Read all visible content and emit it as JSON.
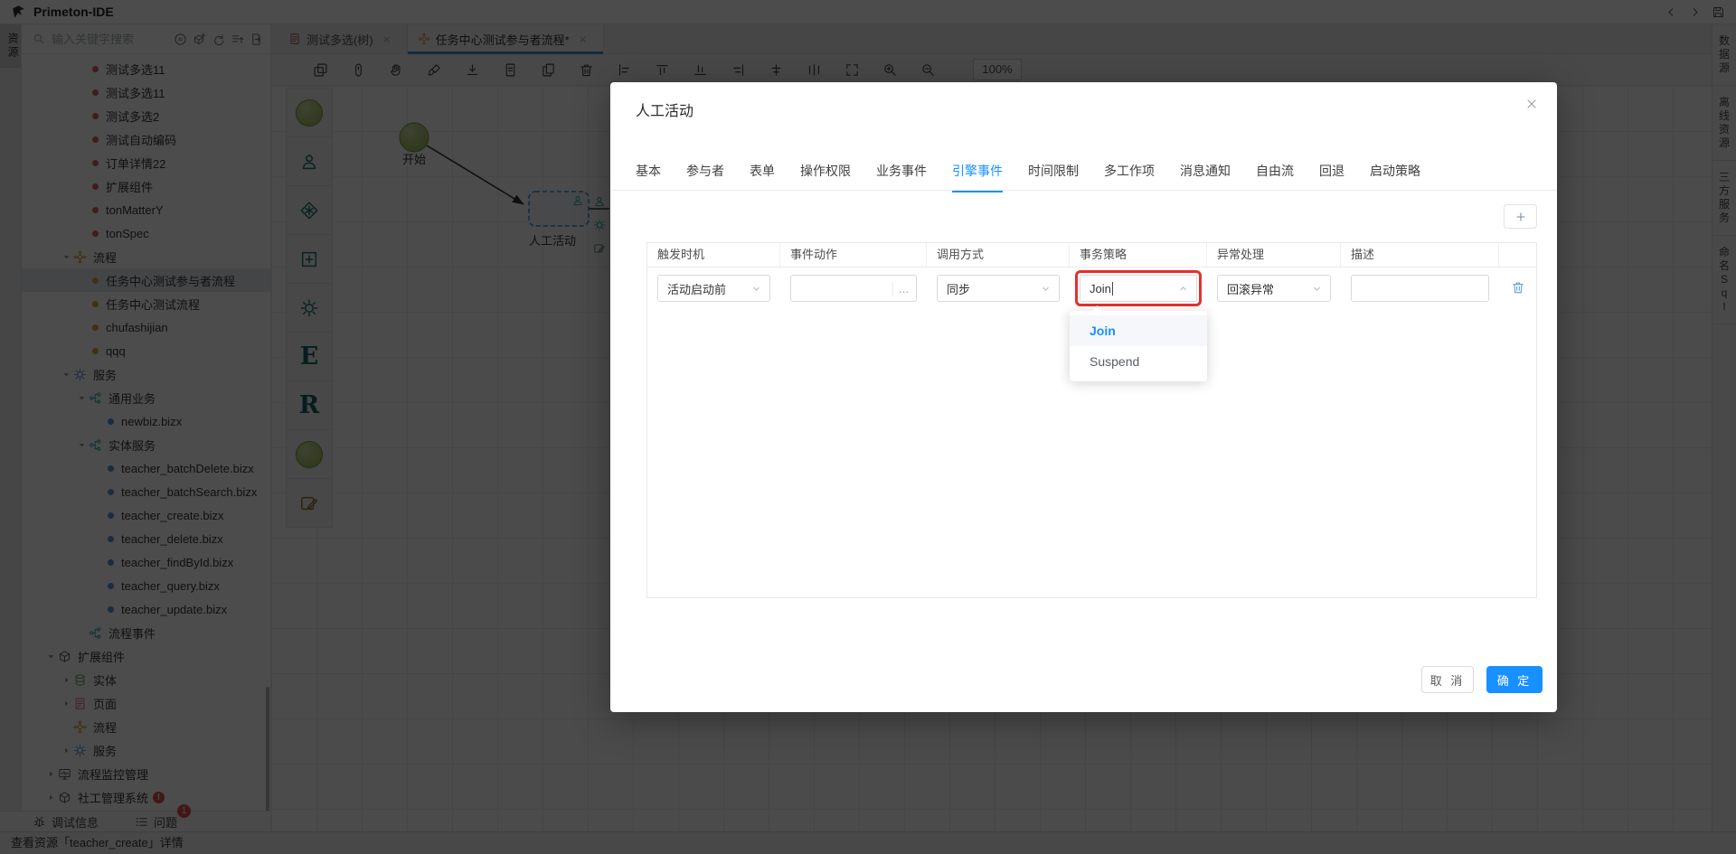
{
  "window": {
    "app_title": "Primeton-IDE",
    "titlebar_icons": [
      "back-icon",
      "forward-icon",
      "save-icon"
    ]
  },
  "left_rail": {
    "tab": "资源"
  },
  "sidebar": {
    "search": {
      "placeholder": "输入关键字搜索",
      "icons": [
        "ai-icon",
        "cube-add-icon",
        "refresh-icon",
        "list-top-icon",
        "export-icon"
      ]
    },
    "tree": [
      {
        "label": "测试多选11",
        "lv": 3,
        "dot": "red"
      },
      {
        "label": "测试多选11",
        "lv": 3,
        "dot": "red"
      },
      {
        "label": "测试多选2",
        "lv": 3,
        "dot": "red"
      },
      {
        "label": "测试自动编码",
        "lv": 3,
        "dot": "red"
      },
      {
        "label": "订单详情22",
        "lv": 3,
        "dot": "red"
      },
      {
        "label": "扩展组件",
        "lv": 3,
        "dot": "red"
      },
      {
        "label": "tonMatterY",
        "lv": 3,
        "dot": "red"
      },
      {
        "label": "tonSpec",
        "lv": 3,
        "dot": "red"
      },
      {
        "label": "流程",
        "lv": 2,
        "caret": "open",
        "icon": "flow-icon"
      },
      {
        "label": "任务中心测试参与者流程",
        "lv": 3,
        "dot": "orange",
        "selected": true
      },
      {
        "label": "任务中心测试流程",
        "lv": 3,
        "dot": "orange"
      },
      {
        "label": "chufashijian",
        "lv": 3,
        "dot": "orange"
      },
      {
        "label": "qqq",
        "lv": 3,
        "dot": "orange"
      },
      {
        "label": "服务",
        "lv": 2,
        "caret": "open",
        "icon": "gear-icon"
      },
      {
        "label": "通用业务",
        "lv": 3,
        "caret": "open",
        "icon": "tree-icon"
      },
      {
        "label": "newbiz.bizx",
        "lv": 4,
        "dot": "blue"
      },
      {
        "label": "实体服务",
        "lv": 3,
        "caret": "open",
        "icon": "tree-icon"
      },
      {
        "label": "teacher_batchDelete.bizx",
        "lv": 4,
        "dot": "blue"
      },
      {
        "label": "teacher_batchSearch.bizx",
        "lv": 4,
        "dot": "blue"
      },
      {
        "label": "teacher_create.bizx",
        "lv": 4,
        "dot": "blue"
      },
      {
        "label": "teacher_delete.bizx",
        "lv": 4,
        "dot": "blue"
      },
      {
        "label": "teacher_findById.bizx",
        "lv": 4,
        "dot": "blue"
      },
      {
        "label": "teacher_query.bizx",
        "lv": 4,
        "dot": "blue"
      },
      {
        "label": "teacher_update.bizx",
        "lv": 4,
        "dot": "blue"
      },
      {
        "label": "流程事件",
        "lv": 3,
        "icon": "tree-icon"
      },
      {
        "label": "扩展组件",
        "lv": 1,
        "caret": "open",
        "icon": "box-icon"
      },
      {
        "label": "实体",
        "lv": 2,
        "caret": "closed",
        "icon": "db-icon"
      },
      {
        "label": "页面",
        "lv": 2,
        "caret": "closed",
        "icon": "page-icon"
      },
      {
        "label": "流程",
        "lv": 2,
        "icon": "flow-icon"
      },
      {
        "label": "服务",
        "lv": 2,
        "caret": "closed",
        "icon": "gear-icon"
      },
      {
        "label": "流程监控管理",
        "lv": 1,
        "caret": "closed",
        "icon": "monitor-icon"
      },
      {
        "label": "社工管理系统",
        "lv": 1,
        "caret": "closed",
        "icon": "box-icon",
        "badge": "!"
      }
    ],
    "debug_bar": [
      {
        "label": "调试信息",
        "icon": "bug-icon"
      },
      {
        "label": "问题",
        "icon": "list-icon",
        "badge": "1"
      }
    ]
  },
  "tabs": [
    {
      "label": "测试多选(树)",
      "icon": "page-icon",
      "active": false
    },
    {
      "label": "任务中心测试参与者流程*",
      "icon": "flow-icon",
      "active": true
    }
  ],
  "canvas": {
    "toolbar": {
      "icons": [
        "copy-icon",
        "mouse-icon",
        "hand-icon",
        "brush-icon",
        "download-icon",
        "file-icon",
        "file-copy-icon",
        "trash-icon",
        "align-left-icon",
        "align-top-icon",
        "align-bottom-icon",
        "align-right-icon",
        "align-middle-icon",
        "distribute-icon",
        "fullscreen-icon",
        "zoom-in-icon",
        "zoom-out-icon"
      ],
      "zoom": "100%"
    },
    "palette": [
      {
        "name": "start-node",
        "shape": "circle"
      },
      {
        "name": "manual-activity",
        "icon": "person-icon"
      },
      {
        "name": "decision-gateway",
        "icon": "diamond-star-icon"
      },
      {
        "name": "subflow",
        "icon": "square-plus-icon"
      },
      {
        "name": "auto-activity",
        "icon": "gear-icon"
      },
      {
        "name": "entity-node",
        "letter": "E"
      },
      {
        "name": "rule-node",
        "letter": "R"
      },
      {
        "name": "end-node",
        "shape": "circle"
      },
      {
        "name": "note",
        "icon": "edit-icon"
      }
    ],
    "nodes": {
      "start": "开始",
      "activity": "人工活动"
    }
  },
  "right_rail": {
    "panels": [
      "数据源",
      "离线资源",
      "三方服务",
      "命名Sql"
    ]
  },
  "statusbar": {
    "text": "查看资源「teacher_create」详情"
  },
  "modal": {
    "title": "人工活动",
    "tabs": [
      {
        "label": "基本"
      },
      {
        "label": "参与者"
      },
      {
        "label": "表单"
      },
      {
        "label": "操作权限"
      },
      {
        "label": "业务事件"
      },
      {
        "label": "引擎事件",
        "active": true
      },
      {
        "label": "时间限制"
      },
      {
        "label": "多工作项"
      },
      {
        "label": "消息通知"
      },
      {
        "label": "自由流"
      },
      {
        "label": "回退"
      },
      {
        "label": "启动策略"
      }
    ],
    "table": {
      "headers": [
        "触发时机",
        "事件动作",
        "调用方式",
        "事务策略",
        "异常处理",
        "描述"
      ],
      "row": {
        "trigger": "活动启动前",
        "action": "",
        "action_more": "...",
        "invoke": "同步",
        "strategy": "Join",
        "exception": "回滚异常",
        "description": ""
      }
    },
    "dropdown": {
      "options": [
        {
          "label": "Join",
          "active": true
        },
        {
          "label": "Suspend",
          "active": false
        }
      ]
    },
    "buttons": {
      "cancel": "取 消",
      "ok": "确 定"
    }
  },
  "colors": {
    "accent": "#1890ff",
    "annotation_red": "#e5302e",
    "tab_underline": "#3f8fd6"
  }
}
